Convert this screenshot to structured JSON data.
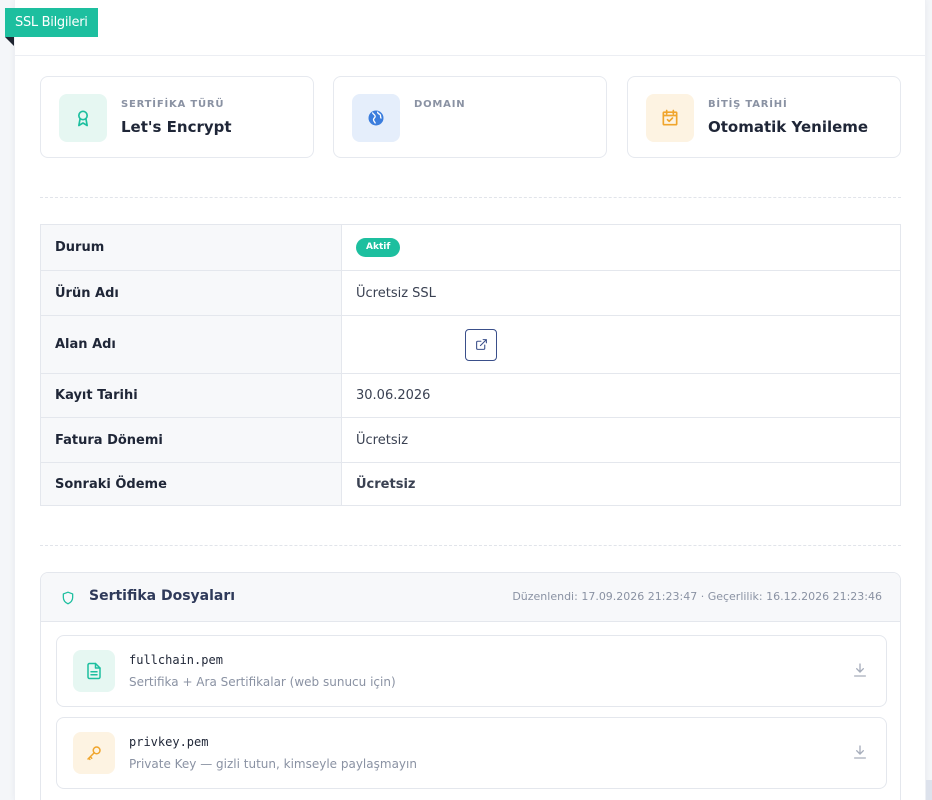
{
  "ribbon": {
    "label": "SSL Bilgileri"
  },
  "cards": [
    {
      "label": "SERTİFİKA TÜRÜ",
      "value": "Let's Encrypt",
      "icon": "award-icon",
      "color": "#1dbf9f"
    },
    {
      "label": "DOMAIN",
      "value": "",
      "icon": "globe-icon",
      "color": "#3b7ddd"
    },
    {
      "label": "BİTİŞ TARİHİ",
      "value": "Otomatik Yenileme",
      "icon": "calendar-check-icon",
      "color": "#f0a52c"
    }
  ],
  "details": {
    "status": {
      "key": "Durum",
      "badge": "Aktif"
    },
    "product": {
      "key": "Ürün Adı",
      "value": "Ücretsiz SSL"
    },
    "domain": {
      "key": "Alan Adı",
      "value": ""
    },
    "registered": {
      "key": "Kayıt Tarihi",
      "value": "30.06.2026"
    },
    "billing": {
      "key": "Fatura Dönemi",
      "value": "Ücretsiz"
    },
    "next_payment": {
      "key": "Sonraki Ödeme",
      "value": "Ücretsiz"
    }
  },
  "files": {
    "title": "Sertifika Dosyaları",
    "meta": "Düzenlendi: 17.09.2026 21:23:47  ·  Geçerlilik: 16.12.2026 21:23:46",
    "items": [
      {
        "name": "fullchain.pem",
        "desc": "Sertifika + Ara Sertifikalar (web sunucu için)",
        "icon": "document-icon"
      },
      {
        "name": "privkey.pem",
        "desc": "Private Key — gizli tutun, kimseyle paylaşmayın",
        "icon": "key-icon"
      }
    ]
  },
  "colors": {
    "accent": "#1dbf9f",
    "blue": "#3b7ddd",
    "amber": "#f0a52c"
  }
}
